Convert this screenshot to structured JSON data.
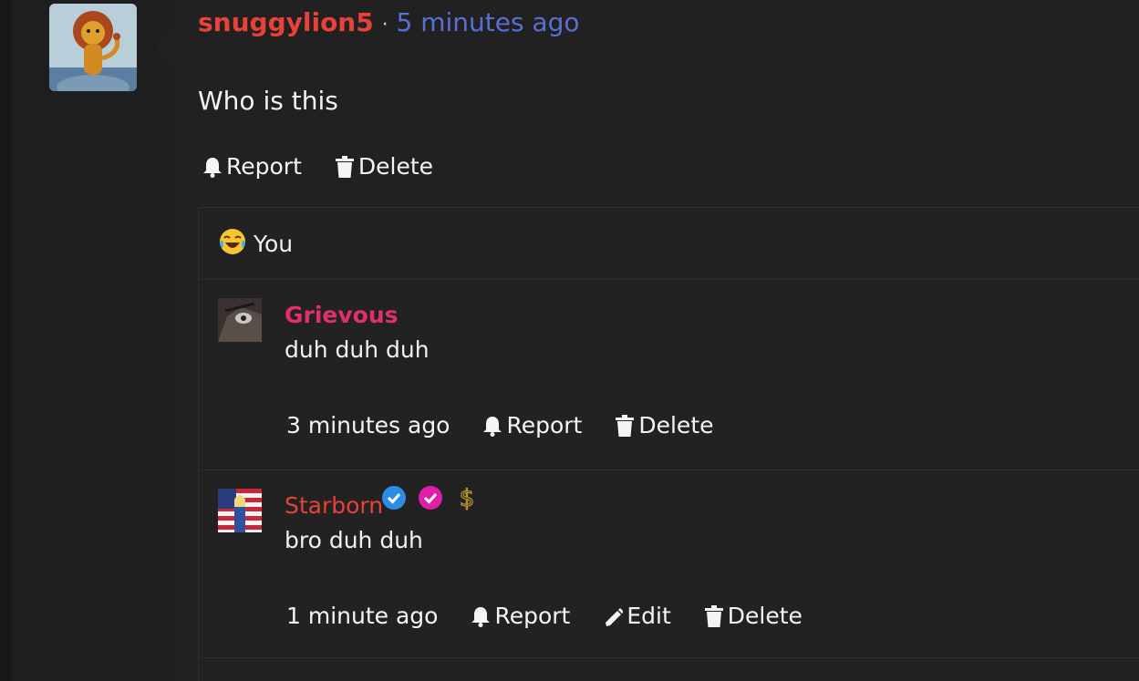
{
  "post": {
    "username": "snuggylion5",
    "separator": "·",
    "time": "5 minutes ago",
    "body": "Who is this",
    "actions": {
      "report": "Report",
      "delete": "Delete"
    }
  },
  "replies_section": {
    "reaction": {
      "emoji_icon": "crying-laughing-emoji-icon",
      "label": "You"
    },
    "replies": [
      {
        "username": "Grievous",
        "username_color": "#e0306a",
        "text": "duh duh duh",
        "time": "3 minutes ago",
        "actions": {
          "report": "Report",
          "delete": "Delete"
        }
      },
      {
        "username": "Starborn",
        "username_color": "#e8413a",
        "text": "bro duh duh",
        "time": "1 minute ago",
        "badges": [
          "verified-blue-icon",
          "verified-pink-icon",
          "dollar-icon"
        ],
        "actions": {
          "report": "Report",
          "edit": "Edit",
          "delete": "Delete"
        }
      }
    ]
  }
}
